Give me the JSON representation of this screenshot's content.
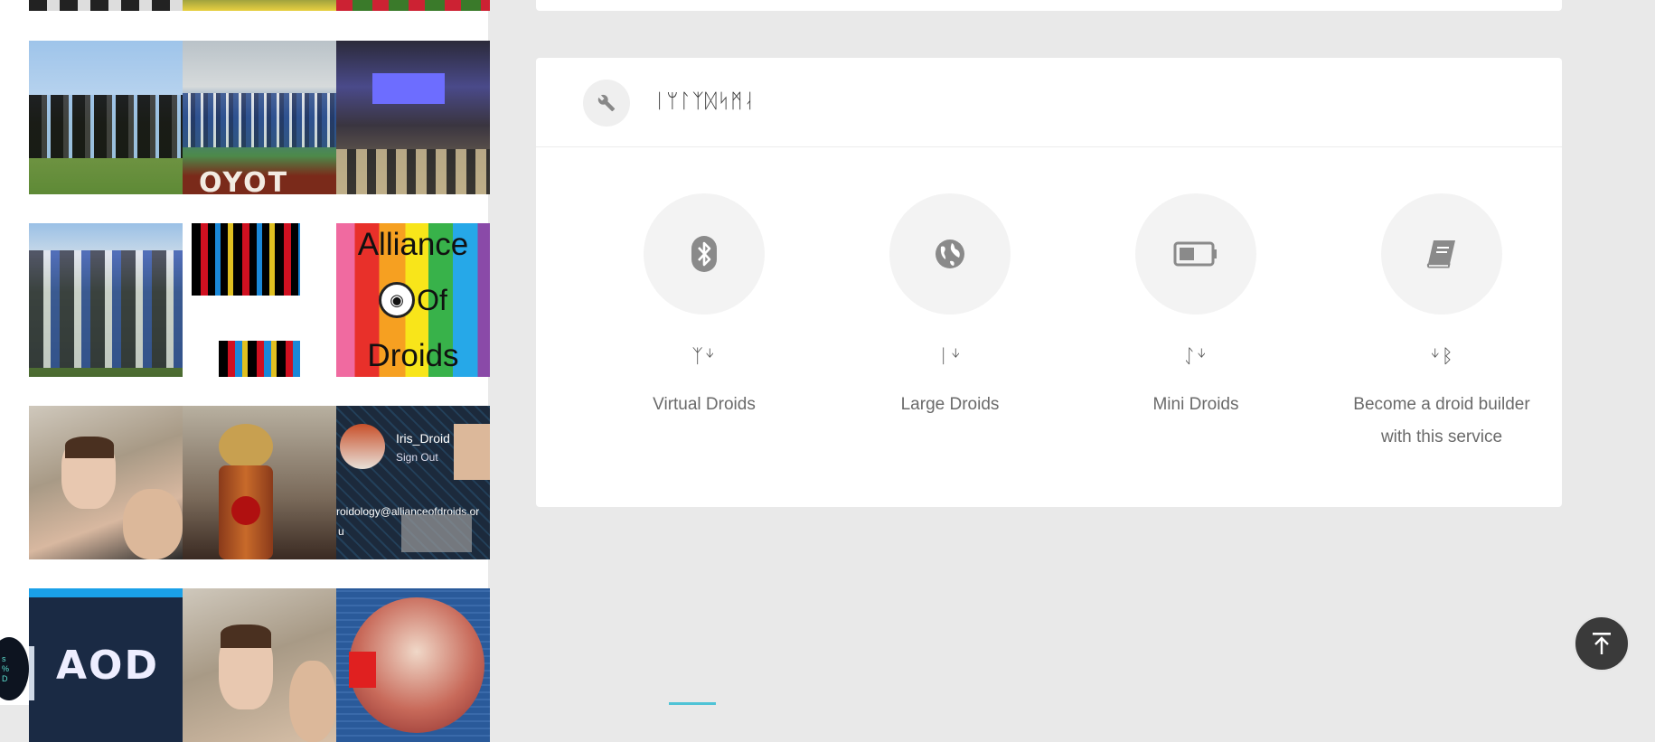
{
  "gallery": {
    "tiles": [
      {
        "name": "team-photo-partial-1"
      },
      {
        "name": "team-photo-partial-2"
      },
      {
        "name": "team-photo-partial-3"
      },
      {
        "name": "team-photo-field"
      },
      {
        "name": "stadium-group-photo"
      },
      {
        "name": "event-hall-photo"
      },
      {
        "name": "seated-team-photo"
      },
      {
        "name": "pixel-art-droid"
      },
      {
        "name": "alliance-of-droids-poster"
      },
      {
        "name": "selfie-photo"
      },
      {
        "name": "brass-droid-photo"
      },
      {
        "name": "iris-droid-profile-screenshot"
      },
      {
        "name": "aod-logo-tile"
      },
      {
        "name": "selfie-photo-2"
      },
      {
        "name": "mars-rover-tile"
      }
    ],
    "poster_text": {
      "line1": "Alliance",
      "line2": "Of",
      "line3": "Droids"
    },
    "profile_tile": {
      "name": "Iris_Droid",
      "signout": "Sign Out",
      "email": "roidology@allianceofdroids.or",
      "extra": "u"
    },
    "aod_tile_text": "AOD",
    "badge_lines": [
      "s",
      "%",
      "D"
    ]
  },
  "services_card": {
    "title": "ᛁᛘᛚᛉᛞᛋᛗᛆ",
    "icon": "wrench-icon",
    "features": [
      {
        "number": "ᛉᛎ",
        "label": "Virtual Droids",
        "icon": "bluetooth-icon"
      },
      {
        "number": "ᛁᛎ",
        "label": "Large Droids",
        "icon": "globe-icon"
      },
      {
        "number": "ᛇᛎ",
        "label": "Mini Droids",
        "icon": "battery-icon"
      },
      {
        "number": "ᛎᛒ",
        "label": "Become a droid builder with this service",
        "icon": "book-icon"
      }
    ]
  },
  "scroll_top": {
    "icon": "arrow-up-icon"
  },
  "colors": {
    "page_bg": "#e9e9e9",
    "card_bg": "#ffffff",
    "icon_circle": "#f3f3f3",
    "accent": "#4fc3d6"
  }
}
